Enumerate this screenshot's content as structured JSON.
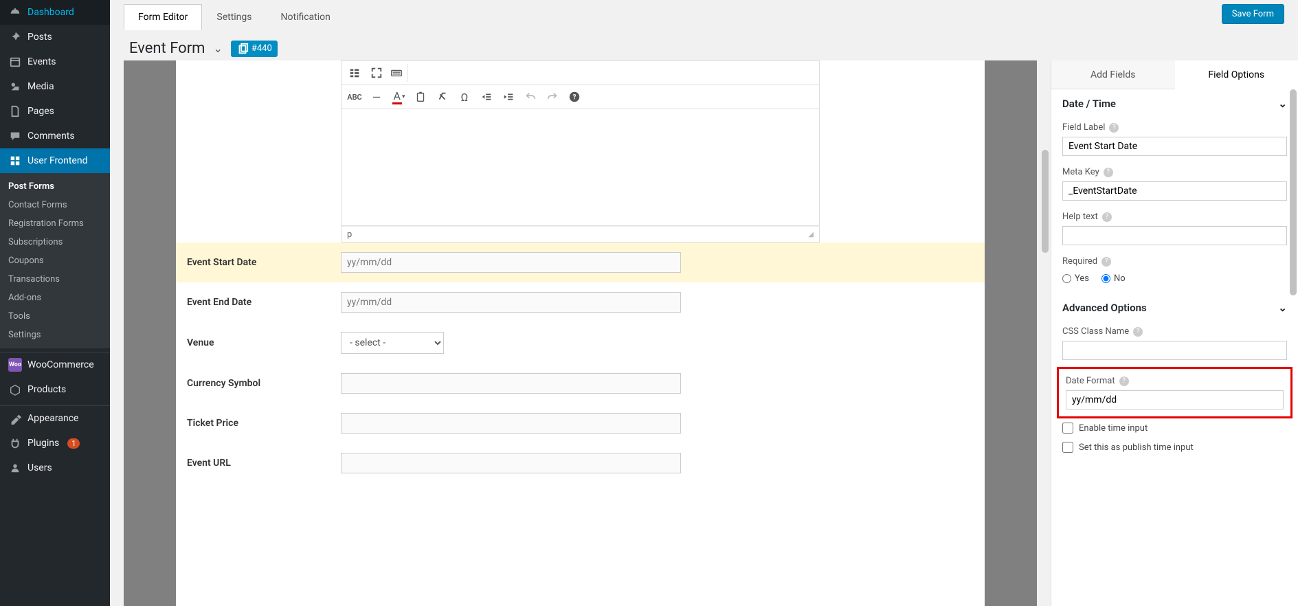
{
  "sidebar": {
    "items": [
      {
        "icon": "dashboard",
        "label": "Dashboard"
      },
      {
        "icon": "pin",
        "label": "Posts"
      },
      {
        "icon": "calendar",
        "label": "Events"
      },
      {
        "icon": "media",
        "label": "Media"
      },
      {
        "icon": "page",
        "label": "Pages"
      },
      {
        "icon": "comment",
        "label": "Comments"
      },
      {
        "icon": "userfrontend",
        "label": "User Frontend"
      },
      {
        "icon": "woo",
        "label": "WooCommerce"
      },
      {
        "icon": "products",
        "label": "Products"
      },
      {
        "icon": "appearance",
        "label": "Appearance"
      },
      {
        "icon": "plugins",
        "label": "Plugins",
        "badge": "1"
      },
      {
        "icon": "users",
        "label": "Users"
      }
    ],
    "submenu": [
      "Post Forms",
      "Contact Forms",
      "Registration Forms",
      "Subscriptions",
      "Coupons",
      "Transactions",
      "Add-ons",
      "Tools",
      "Settings"
    ]
  },
  "tabs": [
    "Form Editor",
    "Settings",
    "Notification"
  ],
  "save_button": "Save Form",
  "form_title": "Event Form",
  "form_id_badge": "#440",
  "editor_status": "p",
  "preview_fields": [
    {
      "label": "Event Start Date",
      "type": "text",
      "placeholder": "yy/mm/dd",
      "highlighted": true
    },
    {
      "label": "Event End Date",
      "type": "text",
      "placeholder": "yy/mm/dd"
    },
    {
      "label": "Venue",
      "type": "select",
      "placeholder": "- select -"
    },
    {
      "label": "Currency Symbol",
      "type": "text",
      "placeholder": ""
    },
    {
      "label": "Ticket Price",
      "type": "text",
      "placeholder": ""
    },
    {
      "label": "Event URL",
      "type": "text",
      "placeholder": ""
    }
  ],
  "right_panel": {
    "tabs": [
      "Add Fields",
      "Field Options"
    ],
    "section_title": "Date / Time",
    "field_label_lbl": "Field Label",
    "field_label_val": "Event Start Date",
    "meta_key_lbl": "Meta Key",
    "meta_key_val": "_EventStartDate",
    "help_text_lbl": "Help text",
    "help_text_val": "",
    "required_lbl": "Required",
    "required_yes": "Yes",
    "required_no": "No",
    "advanced_title": "Advanced Options",
    "css_class_lbl": "CSS Class Name",
    "css_class_val": "",
    "date_format_lbl": "Date Format",
    "date_format_val": "yy/mm/dd",
    "enable_time_lbl": "Enable time input",
    "publish_time_lbl": "Set this as publish time input"
  }
}
